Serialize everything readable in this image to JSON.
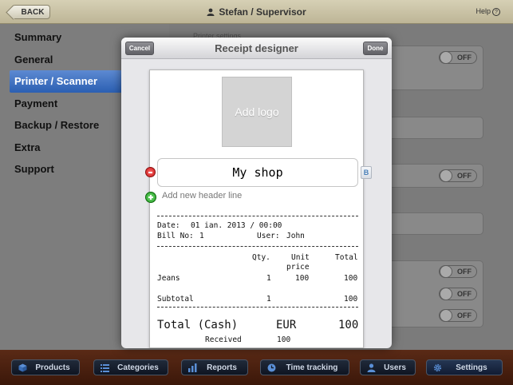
{
  "topbar": {
    "back_label": "BACK",
    "user_label": "Stefan / Supervisor",
    "help_label": "Help",
    "help_glyph": "?"
  },
  "sidebar": {
    "items": [
      {
        "label": "Summary"
      },
      {
        "label": "General"
      },
      {
        "label": "Printer / Scanner",
        "active": true
      },
      {
        "label": "Payment"
      },
      {
        "label": "Backup / Restore"
      },
      {
        "label": "Extra"
      },
      {
        "label": "Support"
      }
    ]
  },
  "background_panel": {
    "section_label": "Printer settings",
    "toggle_label": "OFF"
  },
  "modal": {
    "title": "Receipt designer",
    "cancel_label": "Cancel",
    "done_label": "Done",
    "logo_label": "Add logo",
    "header_line": "My shop",
    "bold_label": "B",
    "add_header_label": "Add new header line",
    "receipt": {
      "date_label": "Date:",
      "date_value": "01 ian. 2013 / 00:00",
      "bill_label": "Bill No:",
      "bill_value": "1",
      "user_label": "User:",
      "user_value": "John",
      "col_qty": "Qty.",
      "col_unit_1": "Unit",
      "col_unit_2": "price",
      "col_total": "Total",
      "item_name": "Jeans",
      "item_qty": "1",
      "item_price": "100",
      "item_total": "100",
      "subtotal_label": "Subtotal",
      "subtotal_qty": "1",
      "subtotal_total": "100",
      "total_label": "Total (Cash)",
      "currency": "EUR",
      "total_value": "100",
      "received_label": "Received",
      "received_value": "100"
    }
  },
  "bottombar": {
    "tabs": [
      {
        "label": "Products",
        "icon": "box-icon"
      },
      {
        "label": "Categories",
        "icon": "list-icon"
      },
      {
        "label": "Reports",
        "icon": "bar-chart-icon"
      },
      {
        "label": "Time tracking",
        "icon": "clock-icon"
      },
      {
        "label": "Users",
        "icon": "user-icon"
      },
      {
        "label": "Settings",
        "icon": "gear-icon",
        "active": true
      }
    ]
  }
}
